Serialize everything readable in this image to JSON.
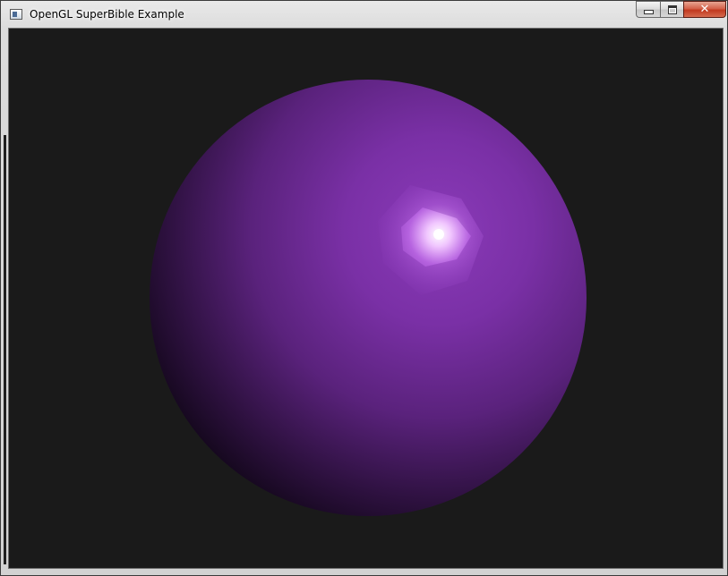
{
  "window": {
    "title": "OpenGL SuperBible Example",
    "icon": "application-window-icon",
    "buttons": {
      "minimize": "minimize-icon",
      "maximize": "maximize-icon",
      "close_label": "✕"
    }
  },
  "scene": {
    "background_color": "#1a1a1a",
    "object": "sphere",
    "sphere_color": "#7b2fa6",
    "highlight_color": "#ffffff"
  }
}
